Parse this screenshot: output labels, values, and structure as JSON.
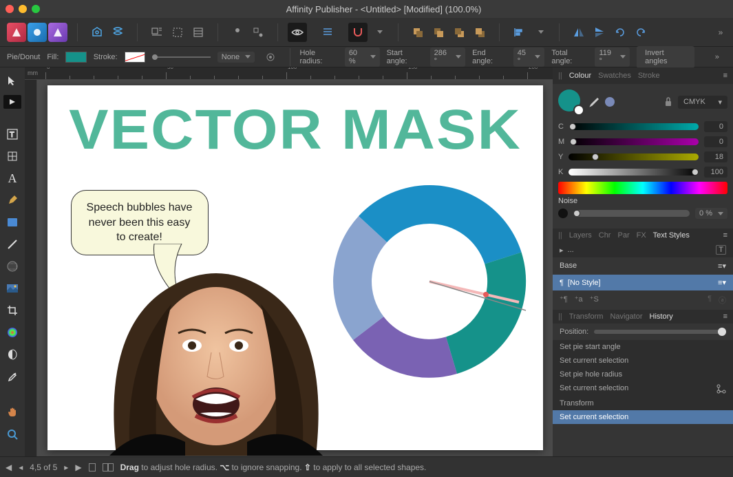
{
  "title": "Affinity Publisher - <Untitled> [Modified] (100.0%)",
  "context": {
    "tool": "Pie/Donut",
    "fill_label": "Fill:",
    "stroke_label": "Stroke:",
    "stroke_width": "None",
    "hole_label": "Hole radius:",
    "hole_value": "60 %",
    "start_label": "Start angle:",
    "start_value": "286 °",
    "end_label": "End angle:",
    "end_value": "45 °",
    "total_label": "Total angle:",
    "total_value": "119 °",
    "invert_label": "Invert angles"
  },
  "ruler_unit": "mm",
  "canvas": {
    "heading": "VECTOR MASK",
    "bubble": "Speech bubbles have never been this easy to create!"
  },
  "chart_data": {
    "type": "pie",
    "title": "",
    "hole_radius_pct": 60,
    "start_angle_deg": 286,
    "end_angle_deg": 45,
    "total_angle_deg": 119,
    "slices": [
      {
        "color": "#1b8fc6",
        "approx_span_deg": 118
      },
      {
        "color": "#15928a",
        "approx_span_deg": 119
      },
      {
        "color": "#7a62b3",
        "approx_span_deg": 78
      },
      {
        "color": "#8aa4cf",
        "approx_span_deg": 45
      }
    ]
  },
  "colour": {
    "tab1": "Colour",
    "tab2": "Swatches",
    "tab3": "Stroke",
    "mode": "CMYK",
    "C": 0,
    "M": 0,
    "Y": 18,
    "K": 100,
    "noise_label": "Noise",
    "noise_value": "0 %"
  },
  "midtabs": {
    "layers": "Layers",
    "chr": "Chr",
    "par": "Par",
    "fx": "FX",
    "styles": "Text Styles"
  },
  "base_label": "Base",
  "nostyle_label": "[No Style]",
  "bottabs": {
    "transform": "Transform",
    "navigator": "Navigator",
    "history": "History"
  },
  "position_label": "Position:",
  "history": [
    "Set pie start angle",
    "Set current selection",
    "Set pie hole radius",
    "Set current selection",
    "Transform",
    "Set current selection"
  ],
  "status": {
    "pages": "4,5 of 5",
    "drag": "Drag",
    "drag_rest": " to adjust hole radius. ",
    "opt": "⌥",
    "opt_rest": " to ignore snapping. ",
    "shift": "⇧",
    "shift_rest": " to apply to all selected shapes."
  }
}
